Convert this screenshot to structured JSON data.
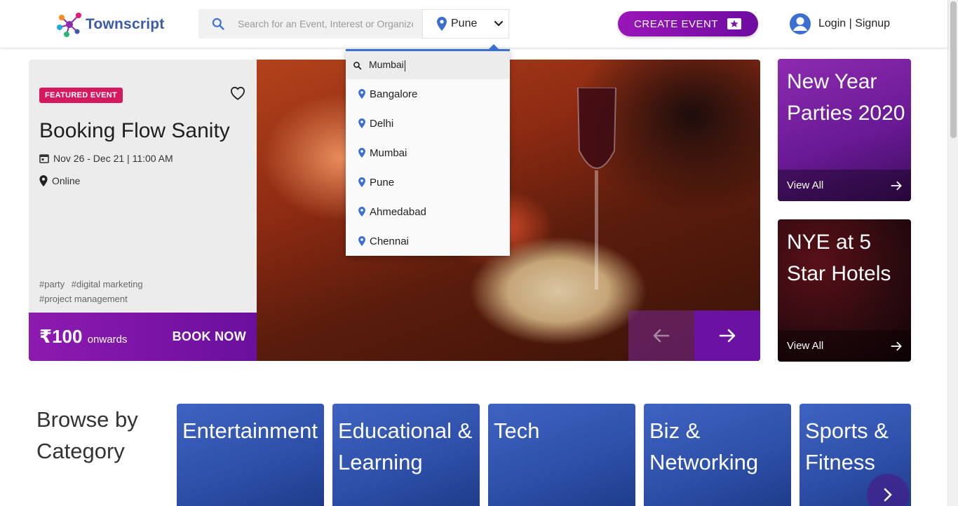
{
  "header": {
    "brand": "Townscript",
    "search_placeholder": "Search for an Event, Interest or Organizer",
    "city": "Pune",
    "create_event": "CREATE EVENT",
    "login": "Login | Signup"
  },
  "city_dropdown": {
    "query": "Mumbai",
    "cities": [
      "Bangalore",
      "Delhi",
      "Mumbai",
      "Pune",
      "Ahmedabad",
      "Chennai"
    ]
  },
  "featured": {
    "badge": "FEATURED EVENT",
    "title": "Booking Flow Sanity",
    "date": "Nov 26 - Dec 21 | 11:00 AM",
    "location": "Online",
    "tags": [
      "#party",
      "#digital marketing",
      "#project management"
    ],
    "price": "₹100",
    "price_suffix": "onwards",
    "book": "BOOK NOW"
  },
  "promos": [
    {
      "title": "New Year Parties 2020",
      "link": "View All"
    },
    {
      "title": "NYE at 5 Star Hotels",
      "link": "View All"
    }
  ],
  "browse": {
    "title": "Browse by Category",
    "categories": [
      "Entertainment",
      "Educational & Learning",
      "Tech",
      "Biz & Networking",
      "Sports & Fitness"
    ]
  },
  "colors": {
    "brand_purple": "#7b13a8",
    "badge_pink": "#d5195e",
    "category_blue": "#3553b3",
    "dropdown_accent": "#3b6fd0"
  }
}
